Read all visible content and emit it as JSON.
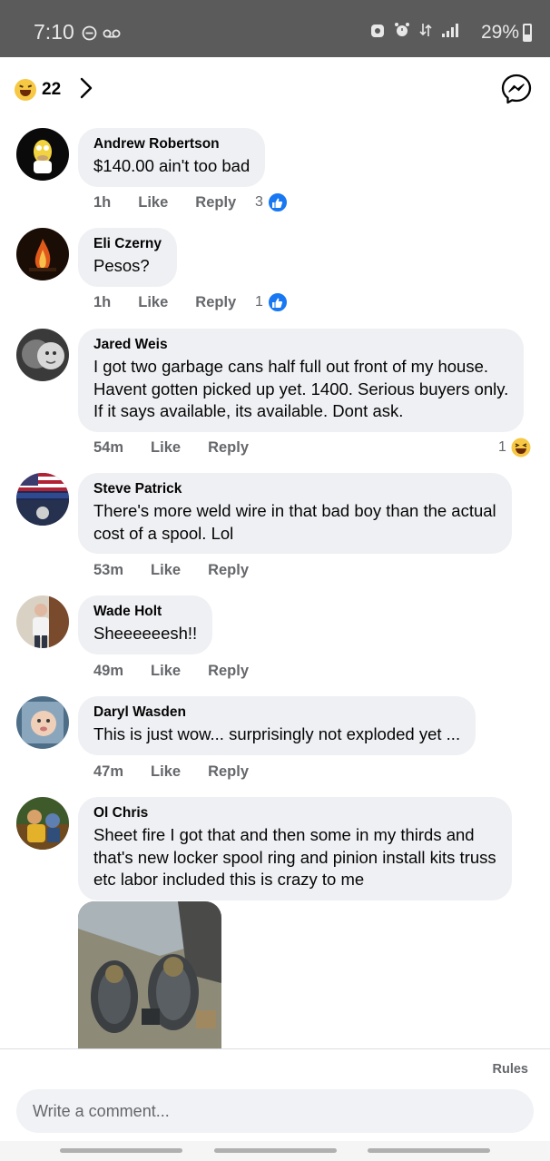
{
  "status_bar": {
    "time": "7:10",
    "battery_percent": "29%"
  },
  "header": {
    "reaction_icon": "haha-emoji",
    "reaction_count": "22",
    "messenger_icon": "messenger-icon"
  },
  "comments": [
    {
      "author": "Andrew Robertson",
      "text": "$140.00 ain't too bad",
      "time": "1h",
      "like_label": "Like",
      "reply_label": "Reply",
      "reaction_count": "3",
      "reaction_type": "like"
    },
    {
      "author": "Eli Czerny",
      "text": "Pesos?",
      "time": "1h",
      "like_label": "Like",
      "reply_label": "Reply",
      "reaction_count": "1",
      "reaction_type": "like"
    },
    {
      "author": "Jared Weis",
      "text": "I got two garbage cans half full out front of my house.\nHavent gotten picked up yet. 1400. Serious buyers only.\nIf it says available, its available. Dont ask.",
      "time": "54m",
      "like_label": "Like",
      "reply_label": "Reply",
      "reaction_count": "1",
      "reaction_type": "haha"
    },
    {
      "author": "Steve Patrick",
      "text": "There's more weld wire in that bad boy than the actual\ncost of a spool. Lol",
      "time": "53m",
      "like_label": "Like",
      "reply_label": "Reply"
    },
    {
      "author": "Wade Holt",
      "text": "Sheeeeeesh!!",
      "time": "49m",
      "like_label": "Like",
      "reply_label": "Reply"
    },
    {
      "author": "Daryl Wasden",
      "text": "This is just wow... surprisingly not exploded yet ...",
      "time": "47m",
      "like_label": "Like",
      "reply_label": "Reply"
    },
    {
      "author": "Ol Chris",
      "text": "Sheet fire I got that and then some in my thirds and\nthat's new locker spool ring and pinion install kits truss\netc labor included this is crazy to me",
      "attachment": "photo"
    }
  ],
  "footer": {
    "rules_label": "Rules",
    "comment_placeholder": "Write a comment..."
  },
  "colors": {
    "bubble_bg": "#eff0f3",
    "meta_gray": "#65676b",
    "like_blue": "#1877f2",
    "status_bar_bg": "#5b5b5b"
  }
}
